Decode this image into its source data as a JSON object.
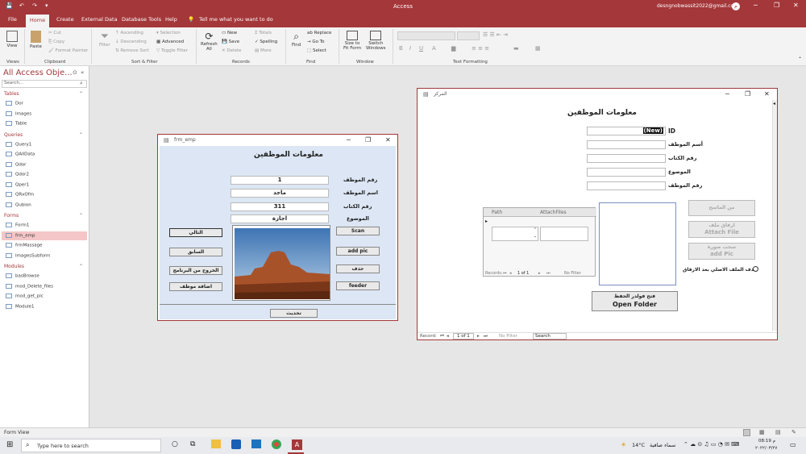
{
  "title": {
    "app": "Access",
    "user": "desngnobwassit2022@gmail.com",
    "user_initial": "م"
  },
  "menu": [
    "File",
    "Home",
    "Create",
    "External Data",
    "Database Tools",
    "Help"
  ],
  "tell_me": "Tell me what you want to do",
  "ribbon": {
    "groups": [
      "Views",
      "Clipboard",
      "Sort & Filter",
      "Records",
      "Find",
      "Window",
      "Text Formatting"
    ],
    "view": "View",
    "paste": "Paste",
    "cut": "Cut",
    "copy": "Copy",
    "format_painter": "Format Painter",
    "filter": "Filter",
    "ascending": "Ascending",
    "descending": "Descending",
    "remove_sort": "Remove Sort",
    "selection": "Selection",
    "advanced": "Advanced",
    "toggle_filter": "Toggle Filter",
    "refresh": "Refresh",
    "refresh_all": "All",
    "new": "New",
    "save": "Save",
    "delete": "Delete",
    "totals": "Totals",
    "spelling": "Spelling",
    "more": "More",
    "find": "Find",
    "replace": "Replace",
    "goto": "Go To",
    "select": "Select",
    "size_to_fit": "Size to",
    "fit_form": "Fit Form",
    "switch": "Switch",
    "windows": "Windows"
  },
  "nav": {
    "title": "All Access Obje...",
    "search": "Search...",
    "sections": [
      {
        "name": "Tables",
        "items": [
          "Dor",
          "Images",
          "Table"
        ]
      },
      {
        "name": "Queries",
        "items": [
          "Query1",
          "QAllData",
          "Qdor",
          "Qdor2",
          "Qper1",
          "QRxOfm",
          "Qubion"
        ]
      },
      {
        "name": "Forms",
        "items": [
          "Form1",
          "frm_emp",
          "frmMassage",
          "ImagesSubform"
        ]
      },
      {
        "name": "Modules",
        "items": [
          "basBrowse",
          "mod_Delete_files",
          "mod_get_pic",
          "Module1"
        ]
      }
    ],
    "selected": "frm_emp"
  },
  "frm_emp": {
    "title": "frm_emp",
    "heading": "معلومات الموظفين",
    "fields": [
      {
        "label": "رقم الموظف",
        "value": "1"
      },
      {
        "label": "اسم الموظف",
        "value": "ماجد"
      },
      {
        "label": "رقم الكتاب",
        "value": "311"
      },
      {
        "label": "الموضوع",
        "value": "اجازة"
      }
    ],
    "buttons_left": [
      "التالي",
      "السابق",
      "الخروج من البرنامج",
      "اضافة موظف"
    ],
    "buttons_right": [
      "Scan",
      "add pic",
      "حذف",
      "feeder"
    ],
    "update": "تحديث"
  },
  "form1": {
    "title": "المركز",
    "heading": "معلومات الموظفين",
    "id_value": "(New)",
    "labels": [
      "ID",
      "أسم الموظف",
      "رقم الكتاب",
      "الموضوع",
      "رقم الموظف"
    ],
    "grid_headers": [
      "Path",
      "AttachFiles"
    ],
    "grid_record": "1 of 1",
    "grid_filter": "No Filter",
    "btn_from_scanner": "من الماسح",
    "btn_attach_ar": "ارفاق ملف",
    "btn_attach": "Attach File",
    "btn_addpic_ar": "سحب صورة",
    "btn_addpic": "add Pic",
    "radio_label": "حذف الملف الاصلي بعد الارفاق",
    "btn_folder_ar": "فتح فولدر الحفظ",
    "btn_folder": "Open Folder",
    "record_label": "Record:",
    "record_value": "1 of 1",
    "filter": "No Filter",
    "search": "Search",
    "record_prefix": "Records:"
  },
  "status": {
    "text": "Form View"
  },
  "taskbar": {
    "search": "Type here to search",
    "weather": "14°C",
    "weather_ar": "سماء صافية",
    "time": "08:19 م",
    "date": "٢٠٢٢/٠٣/٢٧"
  },
  "colors": {
    "brand": "#a4373a",
    "form_bg": "#dce6f4"
  }
}
